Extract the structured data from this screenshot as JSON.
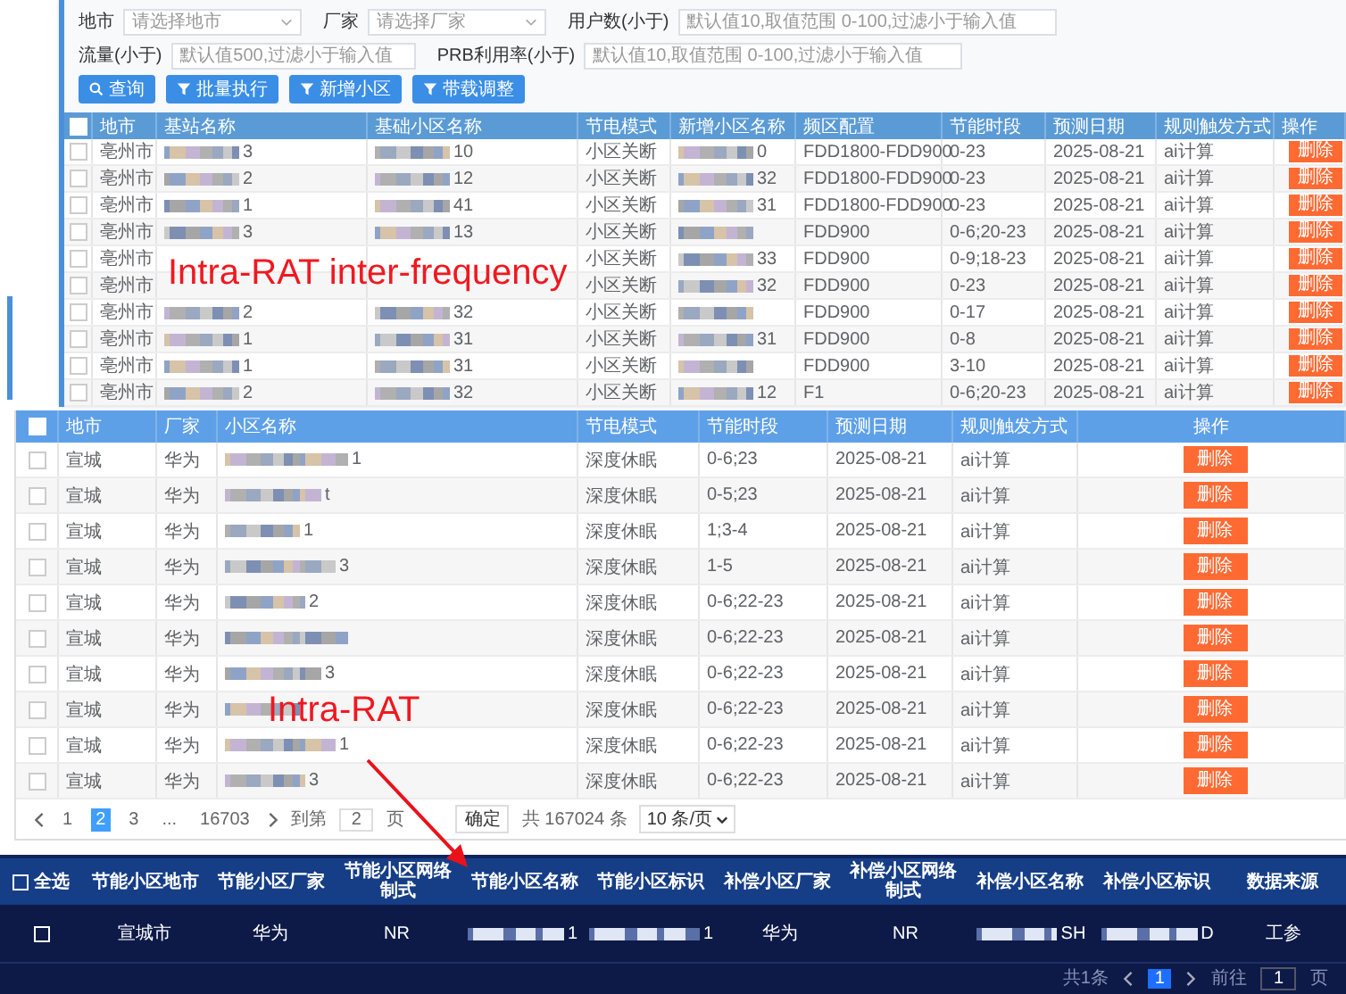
{
  "filters": {
    "fields": [
      {
        "label": "地市",
        "kind": "select",
        "placeholder": "请选择地市"
      },
      {
        "label": "厂家",
        "kind": "select",
        "placeholder": "请选择厂家"
      },
      {
        "label": "用户数(小于)",
        "kind": "input",
        "placeholder": "默认值10,取值范围 0-100,过滤小于输入值"
      },
      {
        "label": "流量(小于)",
        "kind": "input",
        "placeholder": "默认值500,过滤小于输入值"
      },
      {
        "label": "PRB利用率(小于)",
        "kind": "input",
        "placeholder": "默认值10,取值范围 0-100,过滤小于输入值"
      }
    ],
    "buttons": [
      {
        "label": "查询"
      },
      {
        "label": "批量执行"
      },
      {
        "label": "新增小区"
      },
      {
        "label": "带载调整"
      }
    ]
  },
  "top_table": {
    "header_checked": false,
    "columns": [
      "地市",
      "基站名称",
      "基础小区名称",
      "节电模式",
      "新增小区名称",
      "频区配置",
      "节能时段",
      "预测日期",
      "规则触发方式",
      "操作"
    ],
    "rows": [
      {
        "checked": false,
        "cells": [
          {
            "kind": "text",
            "text": "亳州市"
          },
          {
            "kind": "redacted",
            "suffix": "3"
          },
          {
            "kind": "redacted",
            "suffix": "10"
          },
          {
            "kind": "text",
            "text": "小区关断"
          },
          {
            "kind": "redacted",
            "suffix": "0"
          },
          {
            "kind": "text",
            "text": "FDD1800-FDD900"
          },
          {
            "kind": "text",
            "text": "0-23"
          },
          {
            "kind": "text",
            "text": "2025-08-21"
          },
          {
            "kind": "text",
            "text": "ai计算"
          },
          {
            "kind": "button",
            "text": "删除"
          }
        ]
      },
      {
        "checked": false,
        "cells": [
          {
            "kind": "text",
            "text": "亳州市"
          },
          {
            "kind": "redacted",
            "suffix": "2"
          },
          {
            "kind": "redacted",
            "suffix": "12"
          },
          {
            "kind": "text",
            "text": "小区关断"
          },
          {
            "kind": "redacted",
            "suffix": "32"
          },
          {
            "kind": "text",
            "text": "FDD1800-FDD900"
          },
          {
            "kind": "text",
            "text": "0-23"
          },
          {
            "kind": "text",
            "text": "2025-08-21"
          },
          {
            "kind": "text",
            "text": "ai计算"
          },
          {
            "kind": "button",
            "text": "删除"
          }
        ]
      },
      {
        "checked": false,
        "cells": [
          {
            "kind": "text",
            "text": "亳州市"
          },
          {
            "kind": "redacted",
            "suffix": "1"
          },
          {
            "kind": "redacted",
            "suffix": "41"
          },
          {
            "kind": "text",
            "text": "小区关断"
          },
          {
            "kind": "redacted",
            "suffix": "31"
          },
          {
            "kind": "text",
            "text": "FDD1800-FDD900"
          },
          {
            "kind": "text",
            "text": "0-23"
          },
          {
            "kind": "text",
            "text": "2025-08-21"
          },
          {
            "kind": "text",
            "text": "ai计算"
          },
          {
            "kind": "button",
            "text": "删除"
          }
        ]
      },
      {
        "checked": false,
        "cells": [
          {
            "kind": "text",
            "text": "亳州市"
          },
          {
            "kind": "redacted",
            "suffix": "3"
          },
          {
            "kind": "redacted",
            "suffix": "13"
          },
          {
            "kind": "text",
            "text": "小区关断"
          },
          {
            "kind": "redacted"
          },
          {
            "kind": "text",
            "text": "FDD900"
          },
          {
            "kind": "text",
            "text": "0-6;20-23"
          },
          {
            "kind": "text",
            "text": "2025-08-21"
          },
          {
            "kind": "text",
            "text": "ai计算"
          },
          {
            "kind": "button",
            "text": "删除"
          }
        ]
      },
      {
        "checked": false,
        "cells": [
          {
            "kind": "text",
            "text": "亳州市"
          },
          {
            "kind": "covered"
          },
          {
            "kind": "covered"
          },
          {
            "kind": "text",
            "text": "小区关断"
          },
          {
            "kind": "redacted",
            "suffix": "33"
          },
          {
            "kind": "text",
            "text": "FDD900"
          },
          {
            "kind": "text",
            "text": "0-9;18-23"
          },
          {
            "kind": "text",
            "text": "2025-08-21"
          },
          {
            "kind": "text",
            "text": "ai计算"
          },
          {
            "kind": "button",
            "text": "删除"
          }
        ]
      },
      {
        "checked": false,
        "cells": [
          {
            "kind": "text",
            "text": "亳州市"
          },
          {
            "kind": "covered"
          },
          {
            "kind": "covered"
          },
          {
            "kind": "text",
            "text": "小区关断"
          },
          {
            "kind": "redacted",
            "suffix": "32"
          },
          {
            "kind": "text",
            "text": "FDD900"
          },
          {
            "kind": "text",
            "text": "0-23"
          },
          {
            "kind": "text",
            "text": "2025-08-21"
          },
          {
            "kind": "text",
            "text": "ai计算"
          },
          {
            "kind": "button",
            "text": "删除"
          }
        ]
      },
      {
        "checked": false,
        "cells": [
          {
            "kind": "text",
            "text": "亳州市"
          },
          {
            "kind": "redacted",
            "suffix": "2"
          },
          {
            "kind": "redacted",
            "suffix": "32"
          },
          {
            "kind": "text",
            "text": "小区关断"
          },
          {
            "kind": "redacted"
          },
          {
            "kind": "text",
            "text": "FDD900"
          },
          {
            "kind": "text",
            "text": "0-17"
          },
          {
            "kind": "text",
            "text": "2025-08-21"
          },
          {
            "kind": "text",
            "text": "ai计算"
          },
          {
            "kind": "button",
            "text": "删除"
          }
        ]
      },
      {
        "checked": false,
        "cells": [
          {
            "kind": "text",
            "text": "亳州市"
          },
          {
            "kind": "redacted",
            "suffix": "1"
          },
          {
            "kind": "redacted",
            "suffix": "31"
          },
          {
            "kind": "text",
            "text": "小区关断"
          },
          {
            "kind": "redacted",
            "suffix": "31"
          },
          {
            "kind": "text",
            "text": "FDD900"
          },
          {
            "kind": "text",
            "text": "0-8"
          },
          {
            "kind": "text",
            "text": "2025-08-21"
          },
          {
            "kind": "text",
            "text": "ai计算"
          },
          {
            "kind": "button",
            "text": "删除"
          }
        ]
      },
      {
        "checked": false,
        "cells": [
          {
            "kind": "text",
            "text": "亳州市"
          },
          {
            "kind": "redacted",
            "suffix": "1"
          },
          {
            "kind": "redacted",
            "suffix": "31"
          },
          {
            "kind": "text",
            "text": "小区关断"
          },
          {
            "kind": "redacted"
          },
          {
            "kind": "text",
            "text": "FDD900"
          },
          {
            "kind": "text",
            "text": "3-10"
          },
          {
            "kind": "text",
            "text": "2025-08-21"
          },
          {
            "kind": "text",
            "text": "ai计算"
          },
          {
            "kind": "button",
            "text": "删除"
          }
        ]
      },
      {
        "checked": false,
        "cells": [
          {
            "kind": "text",
            "text": "亳州市"
          },
          {
            "kind": "redacted",
            "suffix": "2"
          },
          {
            "kind": "redacted",
            "suffix": "32"
          },
          {
            "kind": "text",
            "text": "小区关断"
          },
          {
            "kind": "redacted",
            "suffix": "12"
          },
          {
            "kind": "text",
            "text": "F1"
          },
          {
            "kind": "text",
            "text": "0-6;20-23"
          },
          {
            "kind": "text",
            "text": "2025-08-21"
          },
          {
            "kind": "text",
            "text": "ai计算"
          },
          {
            "kind": "button",
            "text": "删除"
          }
        ]
      }
    ]
  },
  "middle_table": {
    "header_checked": false,
    "columns": [
      "地市",
      "厂家",
      "小区名称",
      "节电模式",
      "节能时段",
      "预测日期",
      "规则触发方式",
      "操作"
    ],
    "rows": [
      {
        "checked": false,
        "cells": [
          {
            "kind": "text",
            "text": "宣城"
          },
          {
            "kind": "text",
            "text": "华为"
          },
          {
            "kind": "redacted",
            "suffix": "1"
          },
          {
            "kind": "text",
            "text": "深度休眠"
          },
          {
            "kind": "text",
            "text": "0-6;23"
          },
          {
            "kind": "text",
            "text": "2025-08-21"
          },
          {
            "kind": "text",
            "text": "ai计算"
          },
          {
            "kind": "button",
            "text": "删除"
          }
        ]
      },
      {
        "checked": false,
        "cells": [
          {
            "kind": "text",
            "text": "宣城"
          },
          {
            "kind": "text",
            "text": "华为"
          },
          {
            "kind": "redacted",
            "suffix": "t"
          },
          {
            "kind": "text",
            "text": "深度休眠"
          },
          {
            "kind": "text",
            "text": "0-5;23"
          },
          {
            "kind": "text",
            "text": "2025-08-21"
          },
          {
            "kind": "text",
            "text": "ai计算"
          },
          {
            "kind": "button",
            "text": "删除"
          }
        ]
      },
      {
        "checked": false,
        "cells": [
          {
            "kind": "text",
            "text": "宣城"
          },
          {
            "kind": "text",
            "text": "华为"
          },
          {
            "kind": "redacted",
            "suffix": "1"
          },
          {
            "kind": "text",
            "text": "深度休眠"
          },
          {
            "kind": "text",
            "text": "1;3-4"
          },
          {
            "kind": "text",
            "text": "2025-08-21"
          },
          {
            "kind": "text",
            "text": "ai计算"
          },
          {
            "kind": "button",
            "text": "删除"
          }
        ]
      },
      {
        "checked": false,
        "cells": [
          {
            "kind": "text",
            "text": "宣城"
          },
          {
            "kind": "text",
            "text": "华为"
          },
          {
            "kind": "redacted",
            "suffix": "3"
          },
          {
            "kind": "text",
            "text": "深度休眠"
          },
          {
            "kind": "text",
            "text": "1-5"
          },
          {
            "kind": "text",
            "text": "2025-08-21"
          },
          {
            "kind": "text",
            "text": "ai计算"
          },
          {
            "kind": "button",
            "text": "删除"
          }
        ]
      },
      {
        "checked": false,
        "cells": [
          {
            "kind": "text",
            "text": "宣城"
          },
          {
            "kind": "text",
            "text": "华为"
          },
          {
            "kind": "redacted",
            "suffix": "2"
          },
          {
            "kind": "text",
            "text": "深度休眠"
          },
          {
            "kind": "text",
            "text": "0-6;22-23"
          },
          {
            "kind": "text",
            "text": "2025-08-21"
          },
          {
            "kind": "text",
            "text": "ai计算"
          },
          {
            "kind": "button",
            "text": "删除"
          }
        ]
      },
      {
        "checked": false,
        "cells": [
          {
            "kind": "text",
            "text": "宣城"
          },
          {
            "kind": "text",
            "text": "华为"
          },
          {
            "kind": "redacted"
          },
          {
            "kind": "text",
            "text": "深度休眠"
          },
          {
            "kind": "text",
            "text": "0-6;22-23"
          },
          {
            "kind": "text",
            "text": "2025-08-21"
          },
          {
            "kind": "text",
            "text": "ai计算"
          },
          {
            "kind": "button",
            "text": "删除"
          }
        ]
      },
      {
        "checked": false,
        "cells": [
          {
            "kind": "text",
            "text": "宣城"
          },
          {
            "kind": "text",
            "text": "华为"
          },
          {
            "kind": "redacted",
            "suffix": "3"
          },
          {
            "kind": "text",
            "text": "深度休眠"
          },
          {
            "kind": "text",
            "text": "0-6;22-23"
          },
          {
            "kind": "text",
            "text": "2025-08-21"
          },
          {
            "kind": "text",
            "text": "ai计算"
          },
          {
            "kind": "button",
            "text": "删除"
          }
        ]
      },
      {
        "checked": false,
        "cells": [
          {
            "kind": "text",
            "text": "宣城"
          },
          {
            "kind": "text",
            "text": "华为"
          },
          {
            "kind": "redacted"
          },
          {
            "kind": "text",
            "text": "深度休眠"
          },
          {
            "kind": "text",
            "text": "0-6;22-23"
          },
          {
            "kind": "text",
            "text": "2025-08-21"
          },
          {
            "kind": "text",
            "text": "ai计算"
          },
          {
            "kind": "button",
            "text": "删除"
          }
        ]
      },
      {
        "checked": false,
        "cells": [
          {
            "kind": "text",
            "text": "宣城"
          },
          {
            "kind": "text",
            "text": "华为"
          },
          {
            "kind": "redacted",
            "suffix": "1"
          },
          {
            "kind": "text",
            "text": "深度休眠"
          },
          {
            "kind": "text",
            "text": "0-6;22-23"
          },
          {
            "kind": "text",
            "text": "2025-08-21"
          },
          {
            "kind": "text",
            "text": "ai计算"
          },
          {
            "kind": "button",
            "text": "删除"
          }
        ]
      },
      {
        "checked": false,
        "cells": [
          {
            "kind": "text",
            "text": "宣城"
          },
          {
            "kind": "text",
            "text": "华为"
          },
          {
            "kind": "redacted",
            "suffix": "3"
          },
          {
            "kind": "text",
            "text": "深度休眠"
          },
          {
            "kind": "text",
            "text": "0-6;22-23"
          },
          {
            "kind": "text",
            "text": "2025-08-21"
          },
          {
            "kind": "text",
            "text": "ai计算"
          },
          {
            "kind": "button",
            "text": "删除"
          }
        ]
      }
    ],
    "pagination": {
      "pages": [
        {
          "label": "1",
          "selected": false
        },
        {
          "label": "2",
          "selected": true
        },
        {
          "label": "3",
          "selected": false
        },
        {
          "label": "...",
          "selected": false
        },
        {
          "label": "16703",
          "selected": false
        }
      ],
      "goto_label": "到第",
      "goto_value": "2",
      "page_unit": "页",
      "confirm": "确定",
      "total": "共 167024 条",
      "page_size": "10 条/页"
    }
  },
  "bottom_table": {
    "select_all": {
      "label": "全选",
      "checked": false
    },
    "columns": [
      "节能小区地市",
      "节能小区厂家",
      "节能小区网络制式",
      "节能小区名称",
      "节能小区标识",
      "补偿小区厂家",
      "补偿小区网络制式",
      "补偿小区名称",
      "补偿小区标识",
      "数据来源"
    ],
    "rows": [
      {
        "checked": false,
        "cells": [
          {
            "kind": "text",
            "text": "宣城市"
          },
          {
            "kind": "text",
            "text": "华为"
          },
          {
            "kind": "text",
            "text": "NR"
          },
          {
            "kind": "redacted",
            "suffix": "1"
          },
          {
            "kind": "redacted",
            "suffix": "1"
          },
          {
            "kind": "text",
            "text": "华为"
          },
          {
            "kind": "text",
            "text": "NR"
          },
          {
            "kind": "redacted",
            "suffix": "SH"
          },
          {
            "kind": "redacted",
            "suffix": "D"
          },
          {
            "kind": "text",
            "text": "工参"
          }
        ]
      }
    ],
    "pagination": {
      "total": "共1条",
      "pages": [
        {
          "label": "1",
          "selected": true
        }
      ],
      "goto_label": "前往",
      "goto_value": "1",
      "page_unit": "页"
    }
  },
  "annotations": [
    {
      "text": "Intra-RAT inter-frequency"
    },
    {
      "text": "Intra-RAT"
    }
  ]
}
